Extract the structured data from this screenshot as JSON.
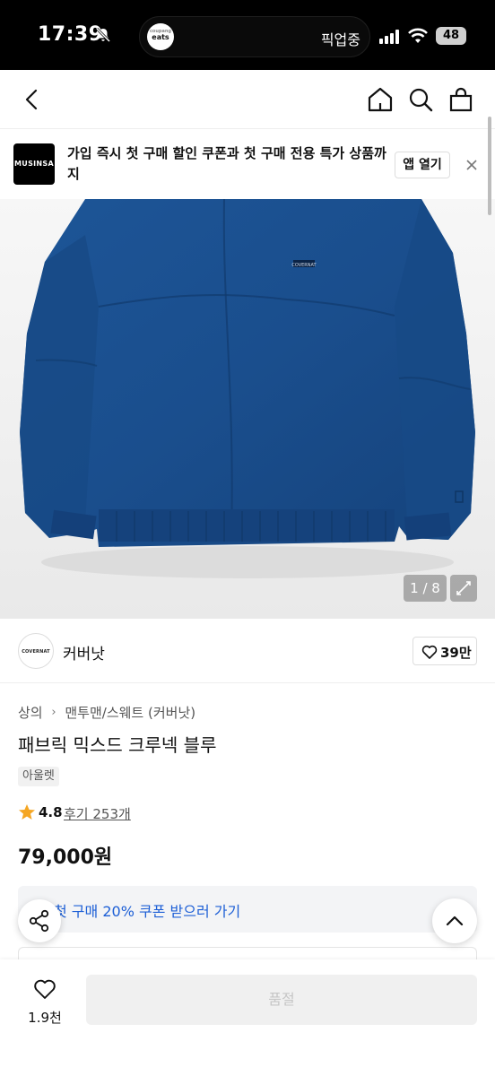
{
  "status_bar": {
    "time": "17:39",
    "island_app_brand_small": "coupang",
    "island_app_brand": "eats",
    "island_status": "픽업중",
    "battery": "48"
  },
  "banner": {
    "logo_text": "MUSINSA",
    "message": "가입 즉시 첫 구매 할인 쿠폰과 첫 구매 전용 특가 상품까지",
    "open_app": "앱 열기"
  },
  "gallery": {
    "counter": "1 / 8",
    "logo_label": "COVERNAT",
    "colors": {
      "garment": "#1c4f8f",
      "garment_dark": "#123b70"
    }
  },
  "brand": {
    "logo_text": "COVERNAT",
    "name": "커버낫",
    "likes": "39만"
  },
  "product": {
    "breadcrumb": [
      "상의",
      "맨투맨/스웨트 (커버낫)"
    ],
    "title": "패브릭 믹스드 크루넥 블루",
    "tag": "아울렛",
    "rating": "4.8",
    "reviews": "후기 253개",
    "price": "79,000원",
    "coupon": "첫 구매 20% 쿠폰 받으러 가기"
  },
  "bottom_bar": {
    "wish_count": "1.9천",
    "buy_button": "품절"
  }
}
